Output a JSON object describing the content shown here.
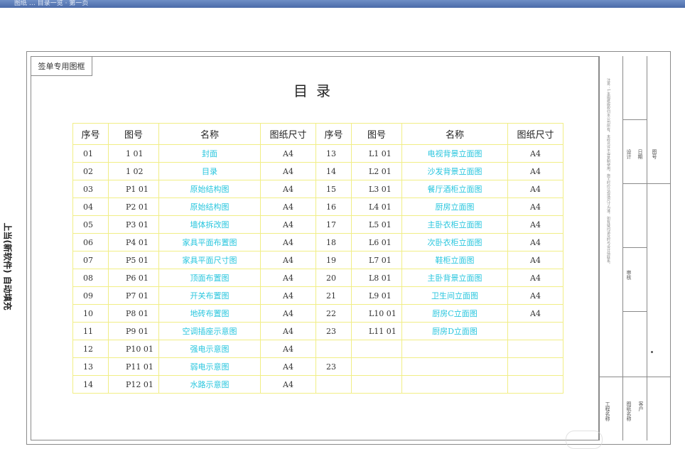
{
  "window": {
    "title_text": "图纸 … 目录一览 · 第一页"
  },
  "side_text": "上当(新软件) 自动填充",
  "tag": {
    "label": "签单专用图框"
  },
  "title": "目录",
  "table": {
    "headers": [
      "序号",
      "图号",
      "名称",
      "图纸尺寸",
      "序号",
      "图号",
      "名称",
      "图纸尺寸"
    ],
    "rows": [
      [
        "01",
        "1 01",
        "封面",
        "A4",
        "13",
        "L1 01",
        "电视背景立面图",
        "A4"
      ],
      [
        "02",
        "1 02",
        "目录",
        "A4",
        "14",
        "L2 01",
        "沙发背景立面图",
        "A4"
      ],
      [
        "03",
        "P1 01",
        "原始结构图",
        "A4",
        "15",
        "L3 01",
        "餐厅酒柜立面图",
        "A4"
      ],
      [
        "04",
        "P2 01",
        "原始结构图",
        "A4",
        "16",
        "L4 01",
        "厨房立面图",
        "A4"
      ],
      [
        "05",
        "P3 01",
        "墙体拆改图",
        "A4",
        "17",
        "L5 01",
        "主卧衣柜立面图",
        "A4"
      ],
      [
        "06",
        "P4 01",
        "家具平面布置图",
        "A4",
        "18",
        "L6 01",
        "次卧衣柜立面图",
        "A4"
      ],
      [
        "07",
        "P5 01",
        "家具平面尺寸图",
        "A4",
        "19",
        "L7 01",
        "鞋柜立面图",
        "A4"
      ],
      [
        "08",
        "P6 01",
        "顶面布置图",
        "A4",
        "20",
        "L8 01",
        "主卧背景立面图",
        "A4"
      ],
      [
        "09",
        "P7 01",
        "开关布置图",
        "A4",
        "21",
        "L9 01",
        "卫生间立面图",
        "A4"
      ],
      [
        "10",
        "P8 01",
        "地砖布置图",
        "A4",
        "22",
        "L10 01",
        "厨房C立面图",
        "A4"
      ],
      [
        "11",
        "P9 01",
        "空调插座示意图",
        "A4",
        "23",
        "L11 01",
        "厨房D立面图",
        ""
      ],
      [
        "12",
        "P10 01",
        "强电示意图",
        "A4",
        "",
        "",
        "",
        ""
      ],
      [
        "13",
        "P11 01",
        "弱电示意图",
        "A4",
        "23",
        "",
        "",
        ""
      ],
      [
        "14",
        "P12 01",
        "水路示意图",
        "A4",
        "",
        "",
        "",
        ""
      ]
    ]
  },
  "title_block": {
    "note_text": "注意：1.本图纸版权归本公司所有，未经允许不得复制使用。施工时应以现场尺寸为准，如有疑问请及时与设计师联系。",
    "labels": [
      "工程名称",
      "图纸名称",
      "设计",
      "审核",
      "日期",
      "图号",
      "客户"
    ]
  },
  "colors": {
    "grid": "#f1ee86",
    "cyan_text": "#29c6de",
    "topbar": "#5a7ab8"
  }
}
